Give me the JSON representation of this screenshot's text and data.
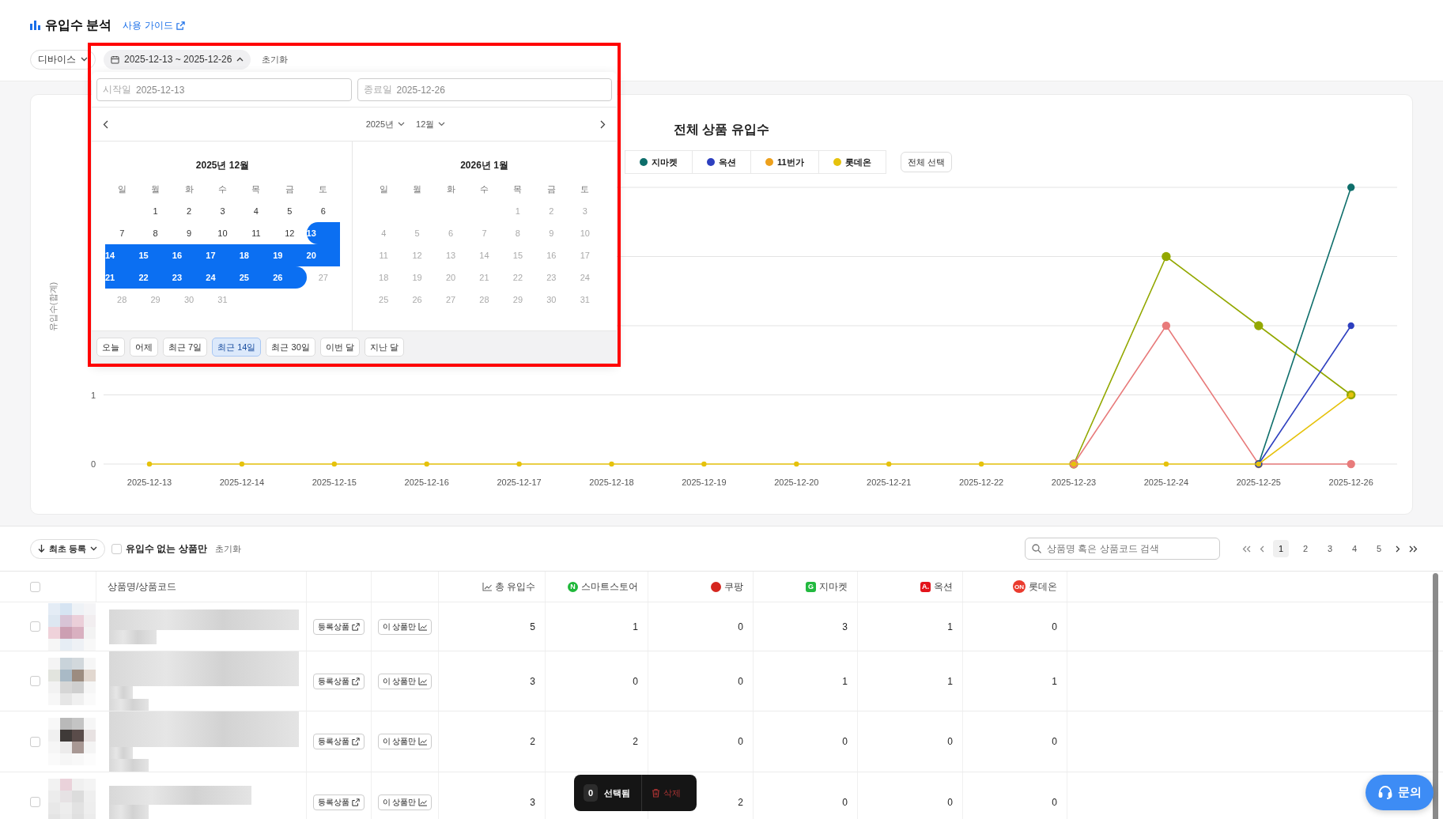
{
  "header": {
    "title": "유입수 분석",
    "guide_link": "사용 가이드"
  },
  "filters": {
    "device": "디바이스",
    "date_range": {
      "label": "2025-12-13 ~ 2025-12-26",
      "expanded": true
    },
    "reset": "초기화"
  },
  "date_picker": {
    "start": {
      "label": "시작일",
      "value": "2025-12-13"
    },
    "end": {
      "label": "종료일",
      "value": "2025-12-26"
    },
    "year": "2025년",
    "month": "12월",
    "months": [
      {
        "title": "2025년 12월",
        "weekdays": [
          "일",
          "월",
          "화",
          "수",
          "목",
          "금",
          "토"
        ],
        "weeks": [
          [
            {
              "label": "1",
              "selected": false,
              "disabled": false
            },
            {
              "label": "2",
              "selected": false,
              "disabled": false
            },
            {
              "label": "3",
              "selected": false,
              "disabled": false
            },
            {
              "label": "4",
              "selected": false,
              "disabled": false
            },
            {
              "label": "5",
              "selected": false,
              "disabled": false
            },
            {
              "label": "6",
              "selected": false,
              "disabled": false
            }
          ],
          [
            {
              "label": "7",
              "selected": false,
              "disabled": false
            },
            {
              "label": "8",
              "selected": false,
              "disabled": false
            },
            {
              "label": "9",
              "selected": false,
              "disabled": false
            },
            {
              "label": "10",
              "selected": false,
              "disabled": false
            },
            {
              "label": "11",
              "selected": false,
              "disabled": false
            },
            {
              "label": "12",
              "selected": false,
              "disabled": false
            },
            {
              "label": "13",
              "selected": true,
              "disabled": false
            }
          ],
          [
            {
              "label": "14",
              "selected": true,
              "disabled": false
            },
            {
              "label": "15",
              "selected": true,
              "disabled": false
            },
            {
              "label": "16",
              "selected": true,
              "disabled": false
            },
            {
              "label": "17",
              "selected": true,
              "disabled": false
            },
            {
              "label": "18",
              "selected": true,
              "disabled": false
            },
            {
              "label": "19",
              "selected": true,
              "disabled": false
            },
            {
              "label": "20",
              "selected": true,
              "disabled": false
            }
          ],
          [
            {
              "label": "21",
              "selected": true,
              "disabled": false
            },
            {
              "label": "22",
              "selected": true,
              "disabled": false
            },
            {
              "label": "23",
              "selected": true,
              "disabled": false
            },
            {
              "label": "24",
              "selected": true,
              "disabled": false
            },
            {
              "label": "25",
              "selected": true,
              "disabled": false
            },
            {
              "label": "26",
              "selected": true,
              "disabled": false
            },
            {
              "label": "27",
              "selected": false,
              "disabled": true
            }
          ],
          [
            {
              "label": "28",
              "selected": false,
              "disabled": true
            },
            {
              "label": "29",
              "selected": false,
              "disabled": true
            },
            {
              "label": "30",
              "selected": false,
              "disabled": true
            },
            {
              "label": "31",
              "selected": false,
              "disabled": true
            }
          ]
        ]
      },
      {
        "title": "2026년 1월",
        "weekdays": [
          "일",
          "월",
          "화",
          "수",
          "목",
          "금",
          "토"
        ],
        "weeks": [
          [
            {
              "label": "1",
              "selected": false,
              "disabled": true
            },
            {
              "label": "2",
              "selected": false,
              "disabled": true
            },
            {
              "label": "3",
              "selected": false,
              "disabled": true
            }
          ],
          [
            {
              "label": "4",
              "selected": false,
              "disabled": true
            },
            {
              "label": "5",
              "selected": false,
              "disabled": true
            },
            {
              "label": "6",
              "selected": false,
              "disabled": true
            },
            {
              "label": "7",
              "selected": false,
              "disabled": true
            },
            {
              "label": "8",
              "selected": false,
              "disabled": true
            },
            {
              "label": "9",
              "selected": false,
              "disabled": true
            },
            {
              "label": "10",
              "selected": false,
              "disabled": true
            }
          ],
          [
            {
              "label": "11",
              "selected": false,
              "disabled": true
            },
            {
              "label": "12",
              "selected": false,
              "disabled": true
            },
            {
              "label": "13",
              "selected": false,
              "disabled": true
            },
            {
              "label": "14",
              "selected": false,
              "disabled": true
            },
            {
              "label": "15",
              "selected": false,
              "disabled": true
            },
            {
              "label": "16",
              "selected": false,
              "disabled": true
            },
            {
              "label": "17",
              "selected": false,
              "disabled": true
            }
          ],
          [
            {
              "label": "18",
              "selected": false,
              "disabled": true
            },
            {
              "label": "19",
              "selected": false,
              "disabled": true
            },
            {
              "label": "20",
              "selected": false,
              "disabled": true
            },
            {
              "label": "21",
              "selected": false,
              "disabled": true
            },
            {
              "label": "22",
              "selected": false,
              "disabled": true
            },
            {
              "label": "23",
              "selected": false,
              "disabled": true
            },
            {
              "label": "24",
              "selected": false,
              "disabled": true
            }
          ],
          [
            {
              "label": "25",
              "selected": false,
              "disabled": true
            },
            {
              "label": "26",
              "selected": false,
              "disabled": true
            },
            {
              "label": "27",
              "selected": false,
              "disabled": true
            },
            {
              "label": "28",
              "selected": false,
              "disabled": true
            },
            {
              "label": "29",
              "selected": false,
              "disabled": true
            },
            {
              "label": "30",
              "selected": false,
              "disabled": true
            },
            {
              "label": "31",
              "selected": false,
              "disabled": true
            }
          ]
        ]
      }
    ],
    "presets": [
      {
        "label": "오늘",
        "selected": false
      },
      {
        "label": "어제",
        "selected": false
      },
      {
        "label": "최근 7일",
        "selected": false
      },
      {
        "label": "최근 14일",
        "selected": true
      },
      {
        "label": "최근 30일",
        "selected": false
      },
      {
        "label": "이번 달",
        "selected": false
      },
      {
        "label": "지난 달",
        "selected": false
      }
    ]
  },
  "chart": {
    "title": "전체 상품 유입수",
    "select_all": "전체 선택",
    "chart_data": {
      "type": "line",
      "ylabel": "유입수(합계)",
      "categories": [
        "2025-12-13",
        "2025-12-14",
        "2025-12-15",
        "2025-12-16",
        "2025-12-17",
        "2025-12-18",
        "2025-12-19",
        "2025-12-20",
        "2025-12-21",
        "2025-12-22",
        "2025-12-23",
        "2025-12-24",
        "2025-12-25",
        "2025-12-26"
      ],
      "ylim": [
        0,
        4
      ],
      "yticks": [
        0,
        1
      ],
      "series": [
        {
          "color": "#93a800",
          "marker": true,
          "values": [
            null,
            null,
            null,
            null,
            null,
            null,
            null,
            null,
            null,
            null,
            0,
            3,
            2,
            1
          ]
        },
        {
          "color": "#e87b7b",
          "marker": true,
          "values": [
            null,
            null,
            null,
            null,
            null,
            null,
            null,
            null,
            null,
            null,
            0,
            2,
            0,
            0
          ]
        },
        {
          "name": "지마켓",
          "color": "#0e6e6b",
          "marker": true,
          "values": [
            null,
            null,
            null,
            null,
            null,
            null,
            null,
            null,
            null,
            null,
            null,
            null,
            0,
            4
          ]
        },
        {
          "name": "옥션",
          "color": "#2d3fbf",
          "marker": true,
          "values": [
            null,
            null,
            null,
            null,
            null,
            null,
            null,
            null,
            null,
            null,
            null,
            null,
            0,
            2
          ]
        },
        {
          "name": "11번가",
          "color": "#eda01c",
          "values": [
            null,
            null,
            null,
            null,
            null,
            null,
            null,
            null,
            null,
            null,
            null,
            null,
            null,
            null
          ]
        },
        {
          "name": "롯데온",
          "color": "#e6c20c",
          "marker": true,
          "values": [
            0,
            0,
            0,
            0,
            0,
            0,
            0,
            0,
            0,
            0,
            0,
            0,
            0,
            1
          ]
        }
      ]
    }
  },
  "toolbar": {
    "sort": "최초 등록",
    "no_inflow_only": {
      "label": "유입수 없는 상품만",
      "checked": false
    },
    "reset": "초기화",
    "search_placeholder": "상품명 혹은 상품코드 검색",
    "pages": [
      {
        "label": "1",
        "selected": true
      },
      {
        "label": "2",
        "selected": false
      },
      {
        "label": "3",
        "selected": false
      },
      {
        "label": "4",
        "selected": false
      },
      {
        "label": "5",
        "selected": false
      }
    ]
  },
  "table": {
    "all_checked": false,
    "product_column": "상품명/상품코드",
    "columns": [
      {
        "label": "총 유입수",
        "kind": "total"
      },
      {
        "label": "스마트스토어",
        "kind": "naver",
        "logo": "N"
      },
      {
        "label": "쿠팡",
        "kind": "coupang"
      },
      {
        "label": "지마켓",
        "kind": "gmarket",
        "logo": "G"
      },
      {
        "label": "옥션",
        "kind": "auction",
        "logo": "A."
      },
      {
        "label": "롯데온",
        "kind": "lotteon",
        "logo": "ON"
      }
    ],
    "rows": [
      {
        "checked": false,
        "registered": "등록상품",
        "only_this": "이 상품만",
        "counts": {
          "total": "5",
          "naver": "1",
          "coupang": "0",
          "gmarket": "3",
          "auction": "1",
          "lotteon": "0"
        }
      },
      {
        "checked": false,
        "registered": "등록상품",
        "only_this": "이 상품만",
        "counts": {
          "total": "3",
          "naver": "0",
          "coupang": "0",
          "gmarket": "1",
          "auction": "1",
          "lotteon": "1"
        }
      },
      {
        "checked": false,
        "registered": "등록상품",
        "only_this": "이 상품만",
        "counts": {
          "total": "2",
          "naver": "2",
          "coupang": "0",
          "gmarket": "0",
          "auction": "0",
          "lotteon": "0"
        }
      },
      {
        "checked": false,
        "registered": "등록상품",
        "only_this": "이 상품만",
        "counts": {
          "total": "3",
          "coupang": "2",
          "gmarket": "0",
          "auction": "0",
          "lotteon": "0"
        }
      }
    ]
  },
  "selection_bar": {
    "count": "0",
    "label": "선택됨",
    "delete": "삭제"
  },
  "help_button": "문의"
}
